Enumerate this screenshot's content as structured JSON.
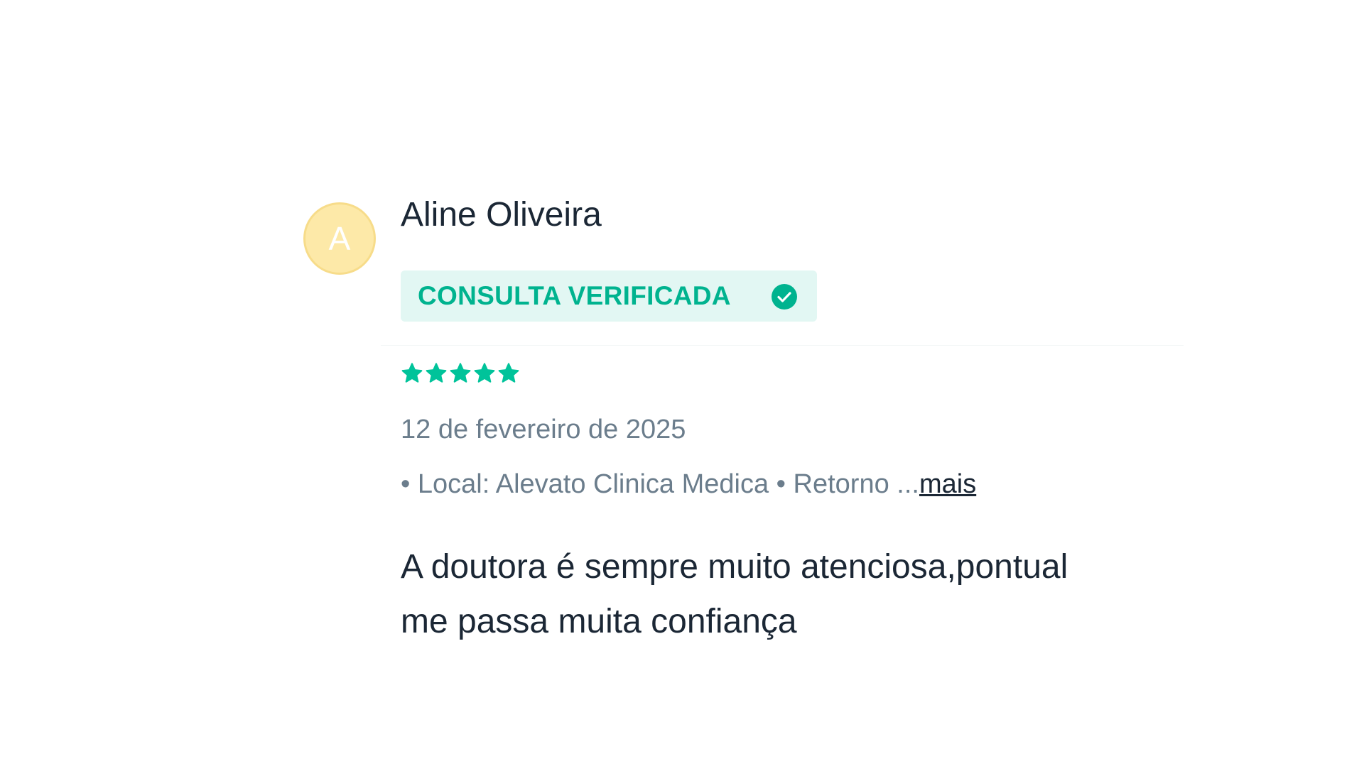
{
  "review": {
    "avatar_letter": "A",
    "author_name": "Aline Oliveira",
    "badge": {
      "label": "CONSULTA VERIFICADA",
      "icon": "check-circle-icon",
      "color": "#00b38f",
      "background": "#e2f7f3"
    },
    "rating": {
      "stars": 5,
      "max": 5,
      "icon": "star-icon",
      "color": "#00c39a"
    },
    "date": "12 de fevereiro de 2025",
    "meta_text": "• Local: Alevato Clinica Medica • Retorno ...",
    "more_label": "mais",
    "comment_line1": "A doutora é sempre muito atenciosa,pontual",
    "comment_line2": "me passa muita confiança"
  }
}
